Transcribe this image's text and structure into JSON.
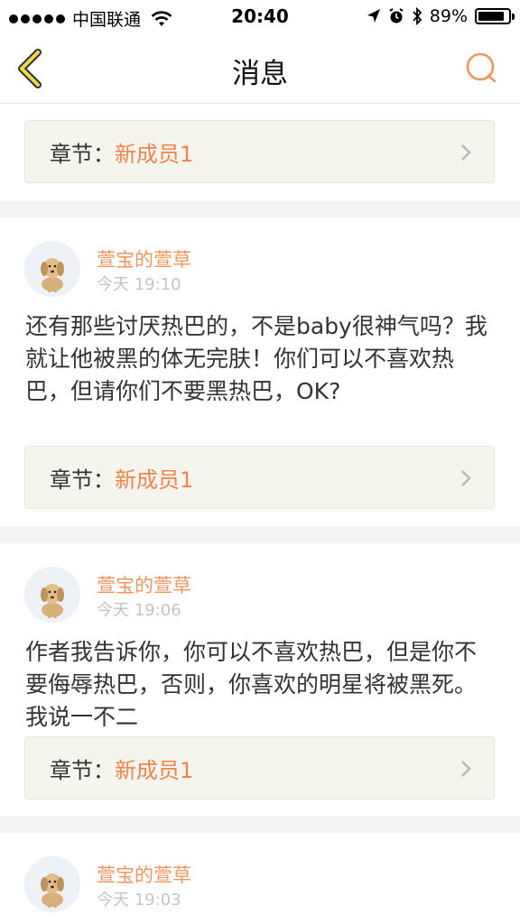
{
  "status_bar": {
    "carrier": "中国联通",
    "time": "20:40",
    "battery": "89%",
    "battery_level": 0.89
  },
  "nav": {
    "title": "消息"
  },
  "chapter_prefix": "章节：",
  "top_chapter": {
    "value": "新成员1"
  },
  "messages": [
    {
      "user": "萱宝的萱草",
      "time": "今天 19:10",
      "text": "还有那些讨厌热巴的，不是baby很神气吗？我就让他被黑的体无完肤！你们可以不喜欢热巴，但请你们不要黑热巴，OK?",
      "chapter": "新成员1"
    },
    {
      "user": "萱宝的萱草",
      "time": "今天 19:06",
      "text": "作者我告诉你，你可以不喜欢热巴，但是你不要侮辱热巴，否则，你喜欢的明星将被黑死。我说一不二",
      "chapter": "新成员1"
    },
    {
      "user": "萱宝的萱草",
      "time": "今天 19:03"
    }
  ]
}
